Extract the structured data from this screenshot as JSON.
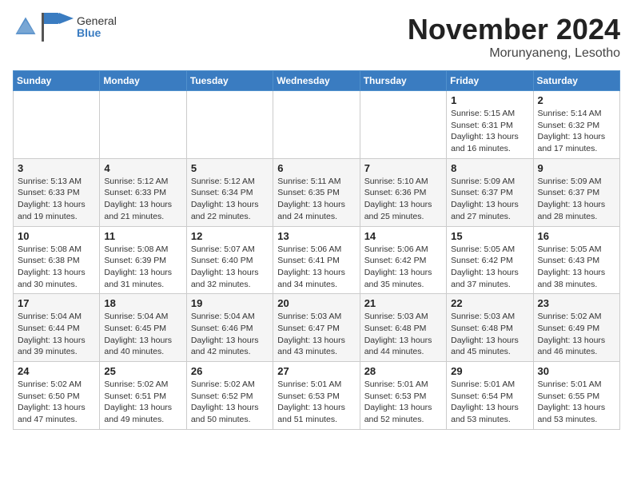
{
  "logo": {
    "general": "General",
    "blue": "Blue"
  },
  "title": "November 2024",
  "location": "Morunyaneng, Lesotho",
  "days_of_week": [
    "Sunday",
    "Monday",
    "Tuesday",
    "Wednesday",
    "Thursday",
    "Friday",
    "Saturday"
  ],
  "weeks": [
    [
      {
        "day": "",
        "info": ""
      },
      {
        "day": "",
        "info": ""
      },
      {
        "day": "",
        "info": ""
      },
      {
        "day": "",
        "info": ""
      },
      {
        "day": "",
        "info": ""
      },
      {
        "day": "1",
        "info": "Sunrise: 5:15 AM\nSunset: 6:31 PM\nDaylight: 13 hours and 16 minutes."
      },
      {
        "day": "2",
        "info": "Sunrise: 5:14 AM\nSunset: 6:32 PM\nDaylight: 13 hours and 17 minutes."
      }
    ],
    [
      {
        "day": "3",
        "info": "Sunrise: 5:13 AM\nSunset: 6:33 PM\nDaylight: 13 hours and 19 minutes."
      },
      {
        "day": "4",
        "info": "Sunrise: 5:12 AM\nSunset: 6:33 PM\nDaylight: 13 hours and 21 minutes."
      },
      {
        "day": "5",
        "info": "Sunrise: 5:12 AM\nSunset: 6:34 PM\nDaylight: 13 hours and 22 minutes."
      },
      {
        "day": "6",
        "info": "Sunrise: 5:11 AM\nSunset: 6:35 PM\nDaylight: 13 hours and 24 minutes."
      },
      {
        "day": "7",
        "info": "Sunrise: 5:10 AM\nSunset: 6:36 PM\nDaylight: 13 hours and 25 minutes."
      },
      {
        "day": "8",
        "info": "Sunrise: 5:09 AM\nSunset: 6:37 PM\nDaylight: 13 hours and 27 minutes."
      },
      {
        "day": "9",
        "info": "Sunrise: 5:09 AM\nSunset: 6:37 PM\nDaylight: 13 hours and 28 minutes."
      }
    ],
    [
      {
        "day": "10",
        "info": "Sunrise: 5:08 AM\nSunset: 6:38 PM\nDaylight: 13 hours and 30 minutes."
      },
      {
        "day": "11",
        "info": "Sunrise: 5:08 AM\nSunset: 6:39 PM\nDaylight: 13 hours and 31 minutes."
      },
      {
        "day": "12",
        "info": "Sunrise: 5:07 AM\nSunset: 6:40 PM\nDaylight: 13 hours and 32 minutes."
      },
      {
        "day": "13",
        "info": "Sunrise: 5:06 AM\nSunset: 6:41 PM\nDaylight: 13 hours and 34 minutes."
      },
      {
        "day": "14",
        "info": "Sunrise: 5:06 AM\nSunset: 6:42 PM\nDaylight: 13 hours and 35 minutes."
      },
      {
        "day": "15",
        "info": "Sunrise: 5:05 AM\nSunset: 6:42 PM\nDaylight: 13 hours and 37 minutes."
      },
      {
        "day": "16",
        "info": "Sunrise: 5:05 AM\nSunset: 6:43 PM\nDaylight: 13 hours and 38 minutes."
      }
    ],
    [
      {
        "day": "17",
        "info": "Sunrise: 5:04 AM\nSunset: 6:44 PM\nDaylight: 13 hours and 39 minutes."
      },
      {
        "day": "18",
        "info": "Sunrise: 5:04 AM\nSunset: 6:45 PM\nDaylight: 13 hours and 40 minutes."
      },
      {
        "day": "19",
        "info": "Sunrise: 5:04 AM\nSunset: 6:46 PM\nDaylight: 13 hours and 42 minutes."
      },
      {
        "day": "20",
        "info": "Sunrise: 5:03 AM\nSunset: 6:47 PM\nDaylight: 13 hours and 43 minutes."
      },
      {
        "day": "21",
        "info": "Sunrise: 5:03 AM\nSunset: 6:48 PM\nDaylight: 13 hours and 44 minutes."
      },
      {
        "day": "22",
        "info": "Sunrise: 5:03 AM\nSunset: 6:48 PM\nDaylight: 13 hours and 45 minutes."
      },
      {
        "day": "23",
        "info": "Sunrise: 5:02 AM\nSunset: 6:49 PM\nDaylight: 13 hours and 46 minutes."
      }
    ],
    [
      {
        "day": "24",
        "info": "Sunrise: 5:02 AM\nSunset: 6:50 PM\nDaylight: 13 hours and 47 minutes."
      },
      {
        "day": "25",
        "info": "Sunrise: 5:02 AM\nSunset: 6:51 PM\nDaylight: 13 hours and 49 minutes."
      },
      {
        "day": "26",
        "info": "Sunrise: 5:02 AM\nSunset: 6:52 PM\nDaylight: 13 hours and 50 minutes."
      },
      {
        "day": "27",
        "info": "Sunrise: 5:01 AM\nSunset: 6:53 PM\nDaylight: 13 hours and 51 minutes."
      },
      {
        "day": "28",
        "info": "Sunrise: 5:01 AM\nSunset: 6:53 PM\nDaylight: 13 hours and 52 minutes."
      },
      {
        "day": "29",
        "info": "Sunrise: 5:01 AM\nSunset: 6:54 PM\nDaylight: 13 hours and 53 minutes."
      },
      {
        "day": "30",
        "info": "Sunrise: 5:01 AM\nSunset: 6:55 PM\nDaylight: 13 hours and 53 minutes."
      }
    ]
  ]
}
